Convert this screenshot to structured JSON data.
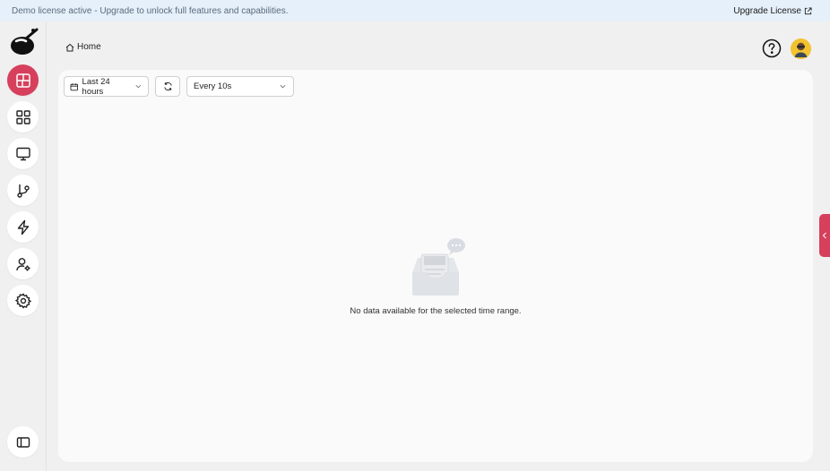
{
  "banner": {
    "text": "Demo license active - Upgrade to unlock full features and capabilities.",
    "upgrade_label": "Upgrade License"
  },
  "sidebar": {
    "items": [
      {
        "icon": "dashboard-icon",
        "active": true
      },
      {
        "icon": "grid-icon",
        "active": false
      },
      {
        "icon": "monitor-icon",
        "active": false
      },
      {
        "icon": "git-branch-icon",
        "active": false
      },
      {
        "icon": "lightning-icon",
        "active": false
      },
      {
        "icon": "user-settings-icon",
        "active": false
      },
      {
        "icon": "gear-icon",
        "active": false
      }
    ],
    "bottom_icon": "sidebar-toggle-icon"
  },
  "header": {
    "breadcrumb": "Home"
  },
  "toolbar": {
    "time_range": "Last 24 hours",
    "refresh_interval": "Every 10s"
  },
  "empty_state": {
    "message": "No data available for the selected time range."
  },
  "colors": {
    "accent": "#d6405c",
    "banner_bg": "#e6f0fa",
    "page_bg": "#f1f0f0",
    "panel_bg": "#fafafa"
  }
}
